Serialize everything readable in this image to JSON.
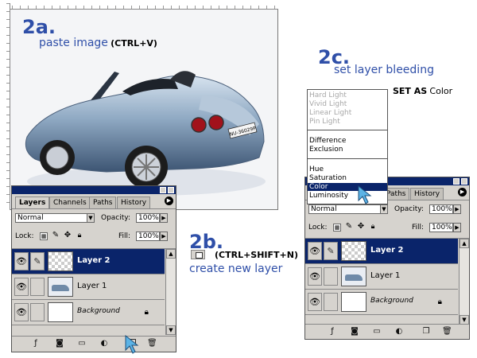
{
  "step_2a": {
    "number": "2a.",
    "action": "paste image",
    "shortcut": "(CTRL+V)"
  },
  "step_2b": {
    "number": "2b.",
    "shortcut": "(CTRL+SHIFT+N)",
    "action": "create new layer"
  },
  "step_2c": {
    "number": "2c.",
    "action": "set layer bleeding",
    "set_as_label": "SET AS",
    "set_as_value": "Color"
  },
  "car_plate": "NU-36029P",
  "left_palette": {
    "tabs": [
      "Layers",
      "Channels",
      "Paths",
      "History"
    ],
    "blend_mode": "Normal",
    "opacity_label": "Opacity:",
    "opacity_value": "100%",
    "lock_label": "Lock:",
    "fill_label": "Fill:",
    "fill_value": "100%",
    "layers": [
      {
        "name": "Layer 2",
        "selected": true,
        "thumb": "transparent"
      },
      {
        "name": "Layer 1",
        "selected": false,
        "thumb": "car"
      },
      {
        "name": "Background",
        "selected": false,
        "thumb": "white",
        "locked": true
      }
    ]
  },
  "right_palette": {
    "tabs": [
      "Paths",
      "History"
    ],
    "blend_mode": "Normal",
    "opacity_label": "Opacity:",
    "opacity_value": "100%",
    "lock_label": "Lock:",
    "fill_label": "Fill:",
    "fill_value": "100%",
    "layers": [
      {
        "name": "Layer 2",
        "selected": true,
        "thumb": "transparent"
      },
      {
        "name": "Layer 1",
        "selected": false,
        "thumb": "car"
      },
      {
        "name": "Background",
        "selected": false,
        "thumb": "white",
        "locked": true
      }
    ]
  },
  "blend_modes": {
    "group1": [
      "Hard Light",
      "Vivid Light",
      "Linear Light",
      "Pin Light"
    ],
    "group2": [
      "Difference",
      "Exclusion"
    ],
    "group3": [
      "Hue",
      "Saturation",
      "Color",
      "Luminosity"
    ],
    "selected": "Color"
  },
  "colors": {
    "accent_blue": "#2f4fa8",
    "selection": "#0a246a",
    "palette_bg": "#d6d3ce"
  }
}
